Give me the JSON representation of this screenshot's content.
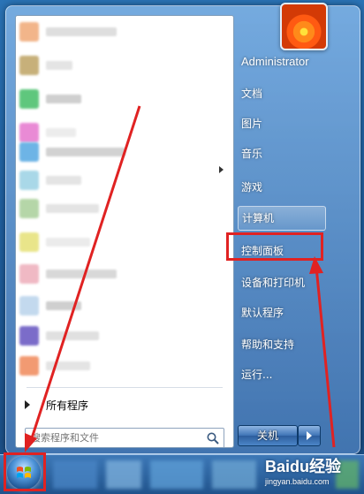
{
  "user": {
    "name": "Administrator"
  },
  "right_menu": {
    "documents": "文档",
    "pictures": "图片",
    "music": "音乐",
    "games": "游戏",
    "computer": "计算机",
    "control_panel": "控制面板",
    "devices_printers": "设备和打印机",
    "default_programs": "默认程序",
    "help_support": "帮助和支持",
    "run": "运行..."
  },
  "left_menu": {
    "all_programs": "所有程序",
    "search_placeholder": "搜索程序和文件"
  },
  "shutdown": {
    "label": "关机"
  },
  "watermark": {
    "brand": "Baidu经验",
    "url": "jingyan.baidu.com"
  },
  "icons": {
    "search": "search-icon",
    "start": "windows-logo-icon",
    "avatar": "flower-avatar-icon",
    "shutdown_menu": "arrow-right-icon"
  },
  "colors": {
    "annotation": "#e02222",
    "menu_text": "#ffffff"
  }
}
